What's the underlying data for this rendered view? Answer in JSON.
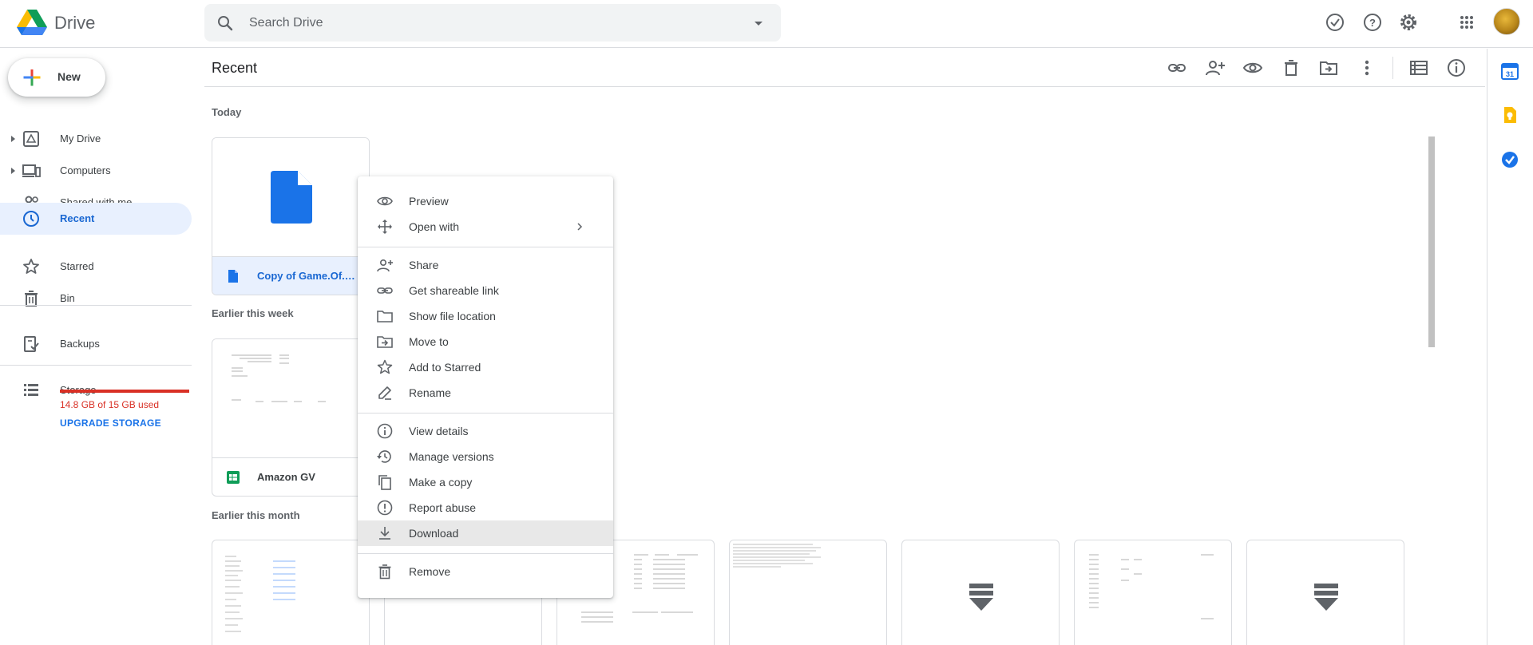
{
  "header": {
    "app_name": "Drive",
    "search_placeholder": "Search Drive"
  },
  "sidebar": {
    "new_label": "New",
    "items": [
      {
        "label": "My Drive",
        "icon": "my-drive-icon",
        "expandable": true
      },
      {
        "label": "Computers",
        "icon": "computers-icon",
        "expandable": true
      },
      {
        "label": "Shared with me",
        "icon": "shared-icon",
        "expandable": false
      },
      {
        "label": "Recent",
        "icon": "clock-icon",
        "expandable": false,
        "active": true
      },
      {
        "label": "Starred",
        "icon": "star-icon",
        "expandable": false
      },
      {
        "label": "Bin",
        "icon": "trash-icon",
        "expandable": false
      }
    ],
    "backups_label": "Backups",
    "storage_label": "Storage",
    "storage_used_text": "14.8 GB of 15 GB used",
    "storage_fraction": 0.987,
    "upgrade_label": "UPGRADE STORAGE"
  },
  "main": {
    "title": "Recent",
    "sections": {
      "today": "Today",
      "week": "Earlier this week",
      "month": "Earlier this month"
    },
    "files": {
      "today": [
        {
          "name": "Copy of Game.Of.Th…",
          "type": "doc",
          "selected": true
        }
      ],
      "week": [
        {
          "name": "Amazon GV",
          "type": "sheet"
        }
      ]
    }
  },
  "context_menu": {
    "groups": [
      [
        {
          "label": "Preview",
          "icon": "eye-icon"
        },
        {
          "label": "Open with",
          "icon": "open-with-icon",
          "submenu": true
        }
      ],
      [
        {
          "label": "Share",
          "icon": "share-icon"
        },
        {
          "label": "Get shareable link",
          "icon": "link-icon"
        },
        {
          "label": "Show file location",
          "icon": "folder-icon"
        },
        {
          "label": "Move to",
          "icon": "move-to-icon"
        },
        {
          "label": "Add to Starred",
          "icon": "star-icon"
        },
        {
          "label": "Rename",
          "icon": "pencil-icon"
        }
      ],
      [
        {
          "label": "View details",
          "icon": "info-icon"
        },
        {
          "label": "Manage versions",
          "icon": "history-icon"
        },
        {
          "label": "Make a copy",
          "icon": "copy-icon"
        },
        {
          "label": "Report abuse",
          "icon": "alert-icon"
        },
        {
          "label": "Download",
          "icon": "download-icon",
          "hover": true
        }
      ],
      [
        {
          "label": "Remove",
          "icon": "trash-icon"
        }
      ]
    ]
  },
  "colors": {
    "accent": "#1a73e8",
    "active_bg": "#e8f0fe",
    "warning": "#d93025",
    "sheet_green": "#0f9d58",
    "doc_blue": "#1a73e8"
  }
}
